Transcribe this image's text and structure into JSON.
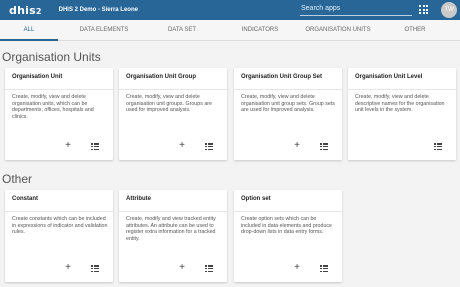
{
  "header": {
    "logo": "dhis",
    "logo_sup": "2",
    "title": "DHIS 2 Demo - Sierra Leone",
    "search_placeholder": "Search apps",
    "avatar_initials": "TW"
  },
  "tabs": [
    {
      "label": "ALL"
    },
    {
      "label": "DATA ELEMENTS"
    },
    {
      "label": "DATA SET"
    },
    {
      "label": "INDICATORS"
    },
    {
      "label": "ORGANISATION UNITS"
    },
    {
      "label": "OTHER"
    }
  ],
  "sections": [
    {
      "title": "Organisation Units",
      "cards": [
        {
          "title": "Organisation Unit",
          "description": "Create, modify, view and delete organisation units, which can be departments, offices, hospitals and clinics.",
          "add": "+"
        },
        {
          "title": "Organisation Unit Group",
          "description": "Create, modify, view and delete organisation unit groups. Groups are used for improved analysis.",
          "add": "+"
        },
        {
          "title": "Organisation Unit Group Set",
          "description": "Create, modify, view and delete organisation unit group sets. Group sets are used for improved analysis.",
          "add": "+"
        },
        {
          "title": "Organisation Unit Level",
          "description": "Create, modify, view and delete descriptive names for the organisation unit levels in the system."
        }
      ]
    },
    {
      "title": "Other",
      "cards": [
        {
          "title": "Constant",
          "description": "Create constants which can be included in expressions of indicator and validation rules.",
          "add": "+"
        },
        {
          "title": "Attribute",
          "description": "Create, modify and view tracked entity attributes. An attribute can be used to register extra information for a tracked entity.",
          "add": "+"
        },
        {
          "title": "Option set",
          "description": "Create option sets which can be included in data elements and produce drop-down lists in data entry forms.",
          "add": "+"
        }
      ]
    }
  ]
}
